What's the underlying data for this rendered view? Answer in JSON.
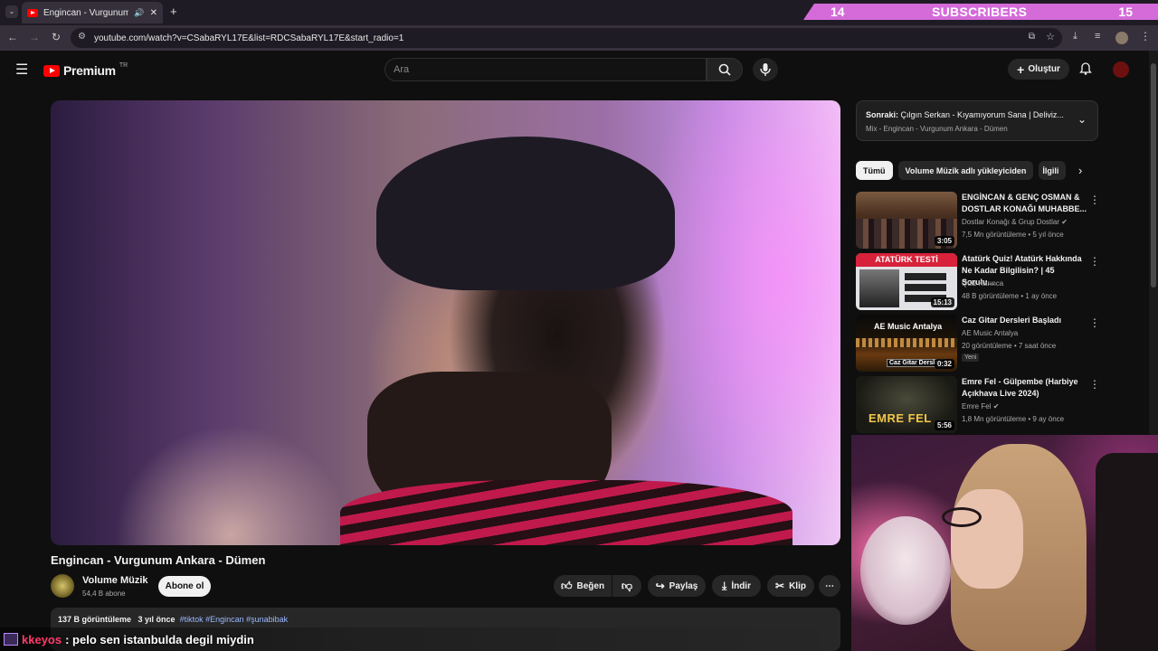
{
  "browser": {
    "tab_title": "Engincan - Vurgunum Ankara - Dümen",
    "url": "youtube.com/watch?v=CSabaRYL17E&list=RDCSabaRYL17E&start_radio=1"
  },
  "overlay": {
    "sub_left": "14",
    "sub_label": "SUBSCRIBERS",
    "sub_right": "15",
    "chat_user": "kkeyos",
    "chat_message": ": pelo sen istanbulda degil miydin"
  },
  "header": {
    "logo_text": "Premium",
    "logo_region": "TR",
    "search_placeholder": "Ara",
    "create_label": "Oluştur"
  },
  "video": {
    "title": "Engincan - Vurgunum Ankara - Dümen",
    "channel_name": "Volume Müzik",
    "channel_subs": "54,4 B abone",
    "subscribe_label": "Abone ol",
    "like_label": "Beğen",
    "share_label": "Paylaş",
    "download_label": "İndir",
    "clip_label": "Klip",
    "views": "137 B görüntüleme",
    "age": "3 yıl önce",
    "tags": "#tiktok #Engincan #şunabibak"
  },
  "sidebar": {
    "upnext_prefix": "Sonraki:",
    "upnext_title": "Çılgın Serkan - Kıyamıyorum Sana | Deliviz...",
    "upnext_mix": "Mix - Engincan - Vurgunum Ankara - Dümen",
    "chips": [
      "Tümü",
      "Volume Müzik adlı yükleyiciden",
      "İlgili"
    ],
    "videos": [
      {
        "title": "ENGİNCAN & GENÇ OSMAN & DOSTLAR KONAĞI MUHABBE...",
        "channel": "Dostlar Konağı & Grup Dostlar",
        "meta": "7,5 Mn görüntüleme • 5 yıl önce",
        "duration": "3:05"
      },
      {
        "title": "Atatürk Quiz! Atatürk Hakkında Ne Kadar Bilgilisin? | 45 Sorulu...",
        "channel": "Quiz Karınca",
        "meta": "48 B görüntüleme • 1 ay önce",
        "duration": "15:13",
        "thumb_text": "ATATÜRK TESTİ"
      },
      {
        "title": "Caz Gitar Dersleri Başladı",
        "channel": "AE Music Antalya",
        "meta": "20 görüntüleme • 7 saat önce",
        "duration": "0:32",
        "badge": "Yeni",
        "thumb_text": "AE Music Antalya",
        "thumb_sub": "Caz Gitar Dersleri"
      },
      {
        "title": "Emre Fel - Gülpembe (Harbiye Açıkhava Live 2024)",
        "channel": "Emre Fel",
        "meta": "1,8 Mn görüntüleme • 9 ay önce",
        "duration": "5:56",
        "thumb_text": "EMRE FEL"
      }
    ]
  }
}
